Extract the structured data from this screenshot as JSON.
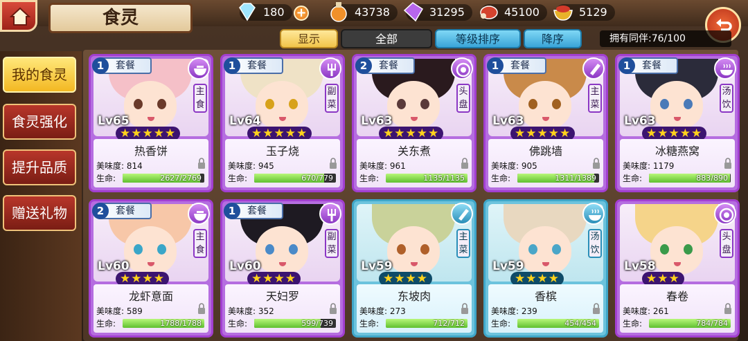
{
  "header": {
    "title": "食灵",
    "resources": [
      {
        "icon": "diamond-icon",
        "value": "180",
        "color": "#7fd7ff"
      },
      {
        "icon": "potion-icon",
        "value": "43738",
        "color": "#e87a1a"
      },
      {
        "icon": "crystal-icon",
        "value": "31295",
        "color": "#b05ae8"
      },
      {
        "icon": "meat-icon",
        "value": "45100",
        "color": "#d0402e"
      },
      {
        "icon": "bowl-icon",
        "value": "5129",
        "color": "#e8b22a"
      }
    ]
  },
  "filters": {
    "show": "显示",
    "all": "全部",
    "sort": "等级排序",
    "order": "降序",
    "owned": "拥有同伴:76/100"
  },
  "sidebar": {
    "items": [
      {
        "label": "我的食灵",
        "active": true
      },
      {
        "label": "食灵强化",
        "active": false
      },
      {
        "label": "提升品质",
        "active": false
      },
      {
        "label": "赠送礼物",
        "active": false
      }
    ]
  },
  "labels": {
    "set": "套餐",
    "taste": "美味度:",
    "hp": "生命:"
  },
  "cards": [
    {
      "name": "热香饼",
      "level": "Lv65",
      "stars": 5,
      "badge": "1",
      "category": "主食",
      "icon": "bowl-icon",
      "taste": "814",
      "hp": "2627/2769",
      "hp_ratio": 0.949,
      "frame": "purple",
      "hair": "#f5c0c8",
      "eye": "#6a3a2a"
    },
    {
      "name": "玉子烧",
      "level": "Lv64",
      "stars": 5,
      "badge": "1",
      "category": "副菜",
      "icon": "fork-icon",
      "taste": "945",
      "hp": "670/779",
      "hp_ratio": 0.86,
      "frame": "purple",
      "hair": "#efe2c6",
      "eye": "#d7a21a"
    },
    {
      "name": "关东煮",
      "level": "Lv63",
      "stars": 5,
      "badge": "2",
      "category": "头盘",
      "icon": "plate-icon",
      "taste": "961",
      "hp": "1135/1135",
      "hp_ratio": 1.0,
      "frame": "purple",
      "hair": "#2a1a1e",
      "eye": "#5a3a3a"
    },
    {
      "name": "佛跳墙",
      "level": "Lv63",
      "stars": 5,
      "badge": "1",
      "category": "主菜",
      "icon": "knife-icon",
      "taste": "905",
      "hp": "1311/1389",
      "hp_ratio": 0.944,
      "frame": "purple",
      "hair": "#c98a4a",
      "eye": "#a06020"
    },
    {
      "name": "冰糖燕窝",
      "level": "Lv63",
      "stars": 5,
      "badge": "1",
      "category": "汤饮",
      "icon": "soup-icon",
      "taste": "1179",
      "hp": "883/890",
      "hp_ratio": 0.992,
      "frame": "purple",
      "hair": "#2b2b3a",
      "eye": "#4a7ab8"
    },
    {
      "name": "龙虾意面",
      "level": "Lv60",
      "stars": 4,
      "badge": "2",
      "category": "主食",
      "icon": "bowl-icon",
      "taste": "589",
      "hp": "1788/1788",
      "hp_ratio": 1.0,
      "frame": "purple",
      "hair": "#f7c7a8",
      "eye": "#3aa6c8"
    },
    {
      "name": "天妇罗",
      "level": "Lv60",
      "stars": 4,
      "badge": "1",
      "category": "副菜",
      "icon": "fork-icon",
      "taste": "352",
      "hp": "599/739",
      "hp_ratio": 0.81,
      "frame": "purple",
      "hair": "#1e1a22",
      "eye": "#4a8ac8"
    },
    {
      "name": "东坡肉",
      "level": "Lv59",
      "stars": 4,
      "badge": "",
      "category": "主菜",
      "icon": "knife-icon",
      "taste": "273",
      "hp": "712/712",
      "hp_ratio": 1.0,
      "frame": "blue",
      "hair": "#c9d29a",
      "eye": "#b0602a"
    },
    {
      "name": "香槟",
      "level": "Lv59",
      "stars": 4,
      "badge": "",
      "category": "汤饮",
      "icon": "soup-icon",
      "taste": "239",
      "hp": "454/454",
      "hp_ratio": 1.0,
      "frame": "blue",
      "hair": "#e8d8c0",
      "eye": "#4aa6c8"
    },
    {
      "name": "春卷",
      "level": "Lv58",
      "stars": 3,
      "badge": "",
      "category": "头盘",
      "icon": "plate-icon",
      "taste": "261",
      "hp": "784/784",
      "hp_ratio": 1.0,
      "frame": "purple",
      "hair": "#f5d48a",
      "eye": "#3a9a4a"
    }
  ]
}
